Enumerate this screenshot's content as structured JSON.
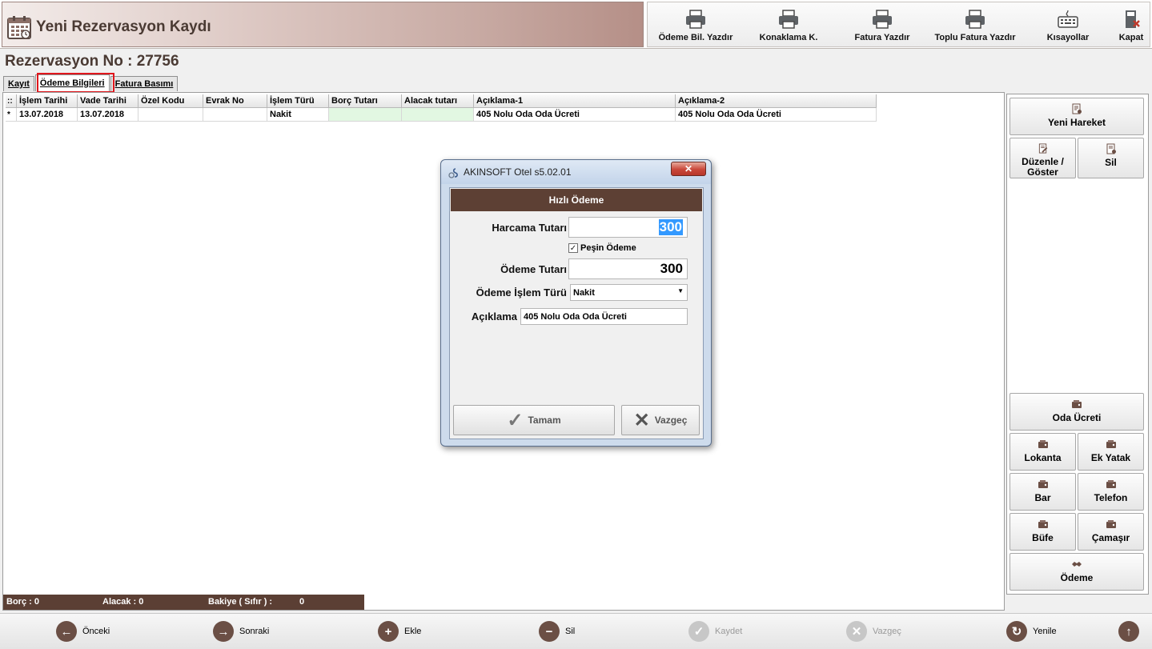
{
  "window": {
    "title": "Yeni Rezervasyon Kaydı"
  },
  "toolbar": {
    "items": [
      {
        "label": "Ödeme Bil. Yazdır",
        "icon": "printer-icon"
      },
      {
        "label": "Konaklama K.",
        "icon": "printer-icon"
      },
      {
        "label": "Fatura Yazdır",
        "icon": "printer-icon"
      },
      {
        "label": "Toplu Fatura Yazdır",
        "icon": "printer-icon"
      },
      {
        "label": "Kısayollar",
        "icon": "keyboard-icon"
      },
      {
        "label": "Kapat",
        "icon": "exit-icon"
      }
    ]
  },
  "reservation": {
    "title": "Rezervasyon No : 27756"
  },
  "tabs": [
    {
      "label": "Kayıt"
    },
    {
      "label": "Ödeme Bilgileri",
      "active": true
    },
    {
      "label": "Fatura Basımı"
    }
  ],
  "grid": {
    "columns": [
      "::",
      "İşlem Tarihi",
      "Vade Tarihi",
      "Özel Kodu",
      "Evrak No",
      "İşlem Türü",
      "Borç Tutarı",
      "Alacak tutarı",
      "Açıklama-1",
      "Açıklama-2"
    ],
    "rows": [
      [
        "*",
        "13.07.2018",
        "13.07.2018",
        "",
        "",
        "Nakit",
        "",
        "",
        "405  Nolu Oda Oda Ücreti",
        "405  Nolu Oda Oda Ücreti"
      ]
    ]
  },
  "summary": {
    "borc": "Borç : 0",
    "alacak": "Alacak : 0",
    "bakiye_label": "Bakiye (   Sıfır   ) :",
    "bakiye_value": "0"
  },
  "right_panel": {
    "yeni_hareket": "Yeni Hareket",
    "duzenle": "Düzenle / Göster",
    "sil": "Sil",
    "oda_ucreti": "Oda Ücreti",
    "lokanta": "Lokanta",
    "ek_yatak": "Ek Yatak",
    "bar": "Bar",
    "telefon": "Telefon",
    "bufe": "Büfe",
    "camasir": "Çamaşır",
    "odeme": "Ödeme"
  },
  "bottom_nav": {
    "onceki": "Önceki",
    "sonraki": "Sonraki",
    "ekle": "Ekle",
    "sil": "Sil",
    "kaydet": "Kaydet",
    "vazgec": "Vazgeç",
    "yenile": "Yenile"
  },
  "dialog": {
    "title": "AKINSOFT Otel s5.02.01",
    "header": "Hızlı Ödeme",
    "harcama_label": "Harcama Tutarı",
    "harcama_value": "300",
    "pesin_label": "Peşin Ödeme",
    "pesin_checked": "✓",
    "odeme_label": "Ödeme Tutarı",
    "odeme_value": "300",
    "islem_turu_label": "Ödeme İşlem Türü",
    "islem_turu_value": "Nakit",
    "aciklama_label": "Açıklama",
    "aciklama_value": "405  Nolu Oda Oda Ücreti",
    "tamam": "Tamam",
    "vazgec": "Vazgeç"
  },
  "colors": {
    "brand_brown": "#5d4034",
    "highlight_red": "#e0161c",
    "selection_blue": "#3399ff",
    "grid_green": "#e2f7e2"
  }
}
